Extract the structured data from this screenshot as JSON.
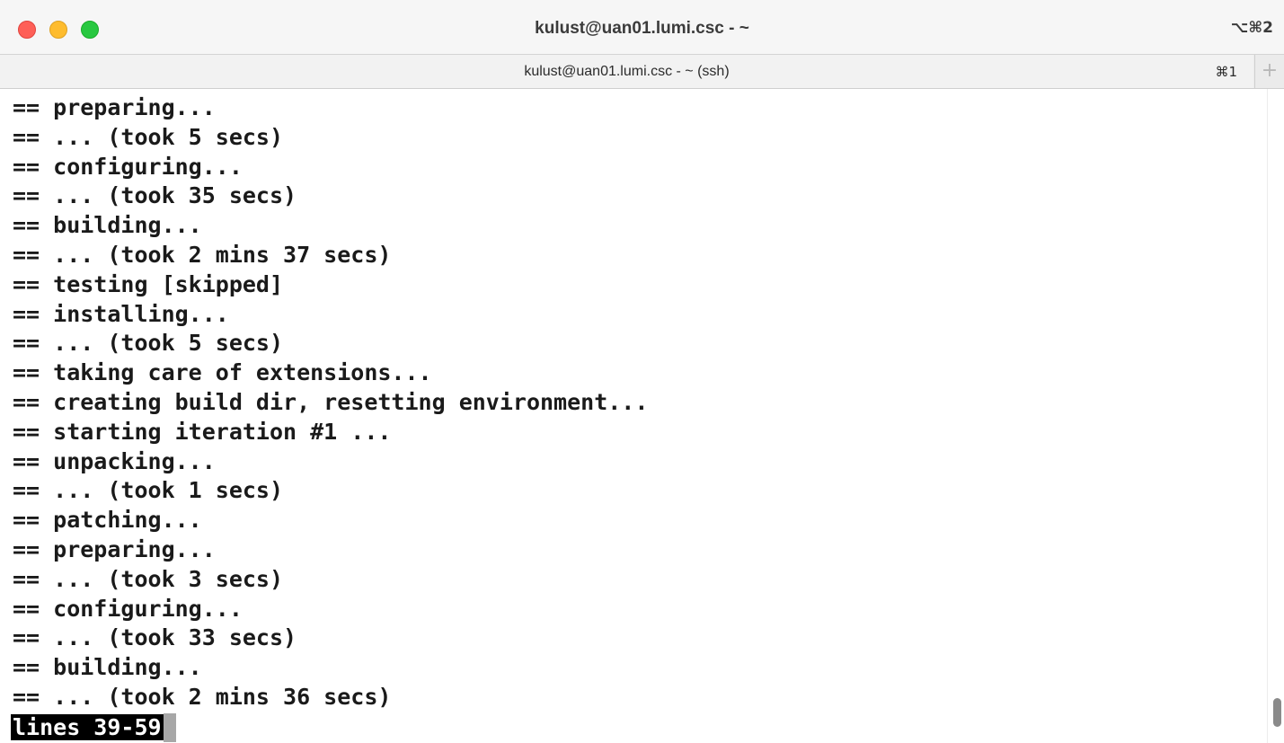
{
  "window": {
    "title": "kulust@uan01.lumi.csc - ~",
    "shortcut": "⌥⌘2"
  },
  "tabbar": {
    "tab_title": "kulust@uan01.lumi.csc - ~ (ssh)",
    "tab_shortcut": "⌘1",
    "new_tab_label": "+"
  },
  "terminal": {
    "lines": [
      "== preparing...",
      "== ... (took 5 secs)",
      "== configuring...",
      "== ... (took 35 secs)",
      "== building...",
      "== ... (took 2 mins 37 secs)",
      "== testing [skipped]",
      "== installing...",
      "== ... (took 5 secs)",
      "== taking care of extensions...",
      "== creating build dir, resetting environment...",
      "== starting iteration #1 ...",
      "== unpacking...",
      "== ... (took 1 secs)",
      "== patching...",
      "== preparing...",
      "== ... (took 3 secs)",
      "== configuring...",
      "== ... (took 33 secs)",
      "== building...",
      "== ... (took 2 mins 36 secs)"
    ],
    "pager_status": "lines 39-59"
  },
  "scrollbar": {
    "position_fraction": 0.98,
    "visible_fraction": 0.05
  },
  "colors": {
    "close": "#fe5f57",
    "minimize": "#febc2e",
    "zoom": "#28c840",
    "terminal_text": "#1a1a1a",
    "terminal_background": "#ffffff"
  }
}
